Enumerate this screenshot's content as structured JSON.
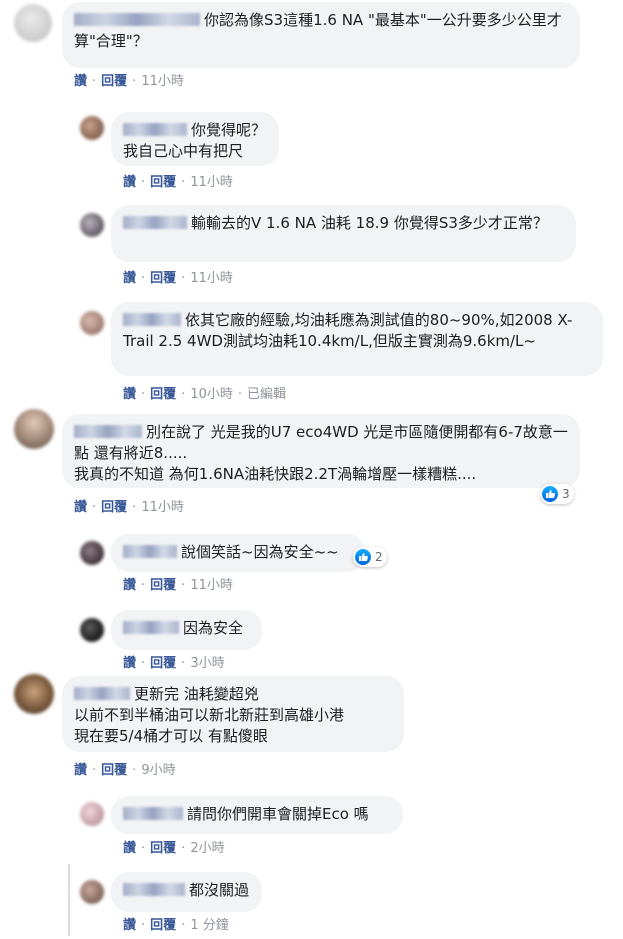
{
  "actions": {
    "like": "讚",
    "reply": "回覆",
    "edited": "已編輯"
  },
  "comments": [
    {
      "text": "你認為像S3這種1.6 NA \"最基本\"一公升要多少公里才算\"合理\"？",
      "time": "11小時"
    },
    {
      "text": "你覺得呢？\n我自己心中有把尺",
      "time": "11小時"
    },
    {
      "text": "輸輸去的V 1.6 NA 油耗 18.9 你覺得S3多少才正常？",
      "time": "11小時"
    },
    {
      "text": "依其它廠的經驗,均油耗應為測試值的80~90%,如2008 X-Trail 2.5 4WD測試均油耗10.4km/L,但版主實測為9.6km/L~",
      "time": "10小時"
    },
    {
      "text": "別在說了 光是我的U7 eco4WD 光是市區隨便開都有6-7故意一點 還有將近8.....\n我真的不知道 為何1.6NA油耗快跟2.2T渦輪增壓一樣糟糕....",
      "time": "11小時",
      "reactions": "3"
    },
    {
      "text": "說個笑話~因為安全~~",
      "time": "11小時",
      "reactions": "2"
    },
    {
      "text": "因為安全",
      "time": "3小時"
    },
    {
      "text": "更新完 油耗變超兇\n以前不到半桶油可以新北新莊到高雄小港\n現在要5/4桶才可以 有點傻眼",
      "time": "9小時"
    },
    {
      "text": "請問你們開車會關掉Eco 嗎",
      "time": "2小時"
    },
    {
      "text": "都沒關過",
      "time": "1 分鐘"
    }
  ],
  "colors": {
    "link": "#385898",
    "meta": "#90949c",
    "bubble": "#f2f3f5"
  }
}
